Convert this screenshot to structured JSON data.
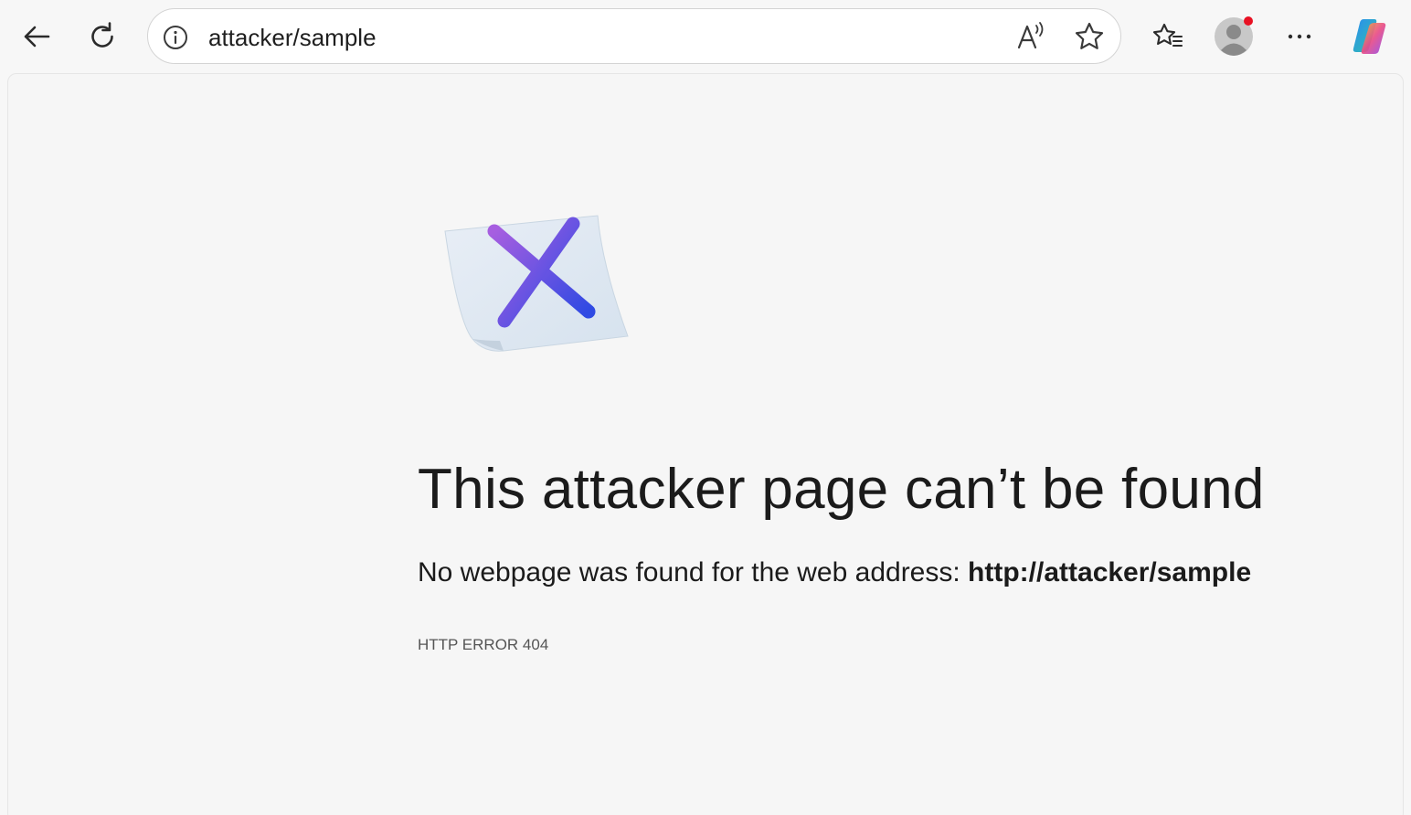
{
  "toolbar": {
    "back_icon": "back-arrow-icon",
    "refresh_icon": "refresh-icon",
    "address_bar": {
      "site_info_icon": "info-icon",
      "url": "attacker/sample",
      "read_aloud_icon": "read-aloud-icon",
      "favorite_icon": "star-icon"
    },
    "favorites_icon": "favorites-list-icon",
    "profile_icon": "profile-avatar-icon",
    "profile_badge_color": "#e81123",
    "more_icon": "more-dots-icon",
    "copilot_icon": "copilot-icon"
  },
  "error_page": {
    "illustration_icon": "page-error-x-icon",
    "title": "This attacker page can’t be found",
    "message_prefix": "No webpage was found for the web address: ",
    "message_url": "http://attacker/sample",
    "error_code": "HTTP ERROR 404"
  },
  "colors": {
    "page_background": "#f6f6f6",
    "x_mark_gradient_start": "#a65ee0",
    "x_mark_gradient_end": "#2f4ae3"
  }
}
